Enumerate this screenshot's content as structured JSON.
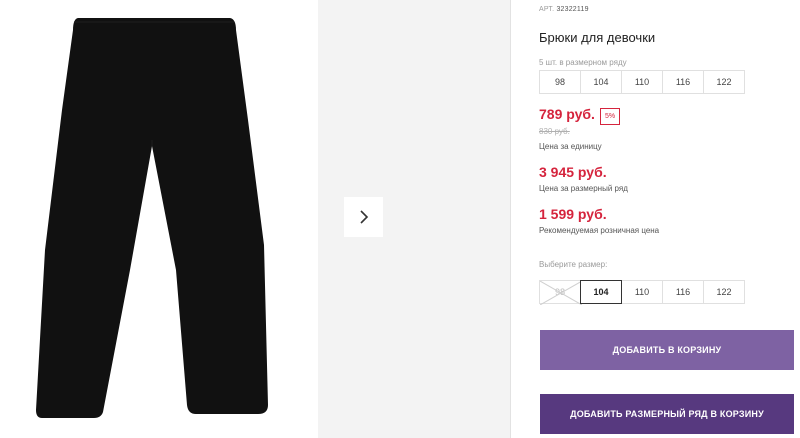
{
  "product": {
    "sku_label": "АРТ.",
    "sku_number": "32322119",
    "title": "Брюки для девочки"
  },
  "size_run": {
    "label": "5 шт. в размерном ряду",
    "sizes": [
      "98",
      "104",
      "110",
      "116",
      "122"
    ]
  },
  "prices": {
    "current": "789 руб.",
    "discount": "5%",
    "old": "830 руб.",
    "unit_note": "Цена за единицу",
    "run_total": "3 945 руб.",
    "run_note": "Цена за размерный ряд",
    "retail": "1 599 руб.",
    "retail_note": "Рекомендуемая розничная цена"
  },
  "size_picker": {
    "label": "Выберите размер:",
    "sizes": [
      "98",
      "104",
      "110",
      "116",
      "122"
    ],
    "selected": "104",
    "unavailable": [
      "98"
    ]
  },
  "buttons": {
    "add_to_cart": "ДОБАВИТЬ В КОРЗИНУ",
    "add_run_to_cart": "ДОБАВИТЬ РАЗМЕРНЫЙ РЯД В КОРЗИНУ"
  },
  "colors": {
    "price": "#d5243d",
    "button_primary": "#7e62a3",
    "button_secondary": "#57397f"
  },
  "icons": {
    "gallery_next": "chevron-right-icon"
  }
}
